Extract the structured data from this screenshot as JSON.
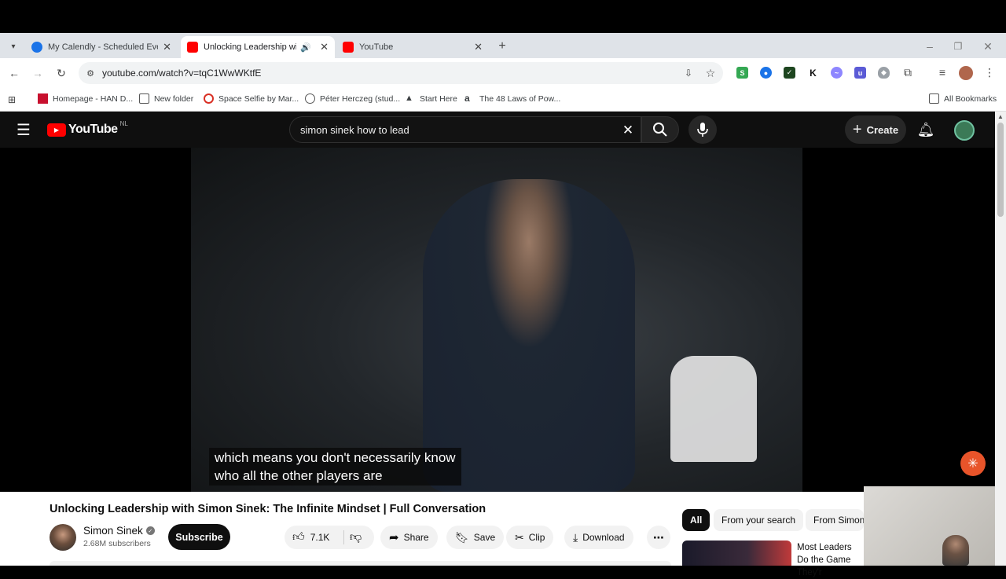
{
  "tabs": [
    {
      "title": "My Calendly - Scheduled Events",
      "color": "#1a73e8"
    },
    {
      "title": "Unlocking Leadership with Simon Sinek",
      "color": "#ff0000"
    },
    {
      "title": "YouTube",
      "color": "#ff0000"
    }
  ],
  "address": {
    "url": "youtube.com/watch?v=tqC1WwWKtfE"
  },
  "bookmarks": [
    {
      "label": "Homepage - HAN D..."
    },
    {
      "label": "New folder"
    },
    {
      "label": "Space Selfie by Mar..."
    },
    {
      "label": "Péter Herczeg (stud..."
    },
    {
      "label": "Start Here"
    },
    {
      "label": "The 48 Laws of Pow..."
    }
  ],
  "all_bookmarks": "All Bookmarks",
  "youtube": {
    "logo": "YouTube",
    "region": "NL",
    "search_query": "simon sinek how to lead",
    "create_label": "Create"
  },
  "player": {
    "caption_line1": "which means you don't necessarily know",
    "caption_line2": "who all the other players are"
  },
  "video": {
    "title": "Unlocking Leadership with Simon Sinek: The Infinite Mindset | Full Conversation",
    "channel": "Simon Sinek",
    "subscribers": "2.68M subscribers",
    "subscribe_label": "Subscribe",
    "likes": "7.1K",
    "share_label": "Share",
    "save_label": "Save",
    "clip_label": "Clip",
    "download_label": "Download"
  },
  "filters": {
    "all": "All",
    "from_search": "From your search",
    "from_channel": "From Simon"
  },
  "recommendation": {
    "title": "Most Leaders Do the Game They'r"
  }
}
